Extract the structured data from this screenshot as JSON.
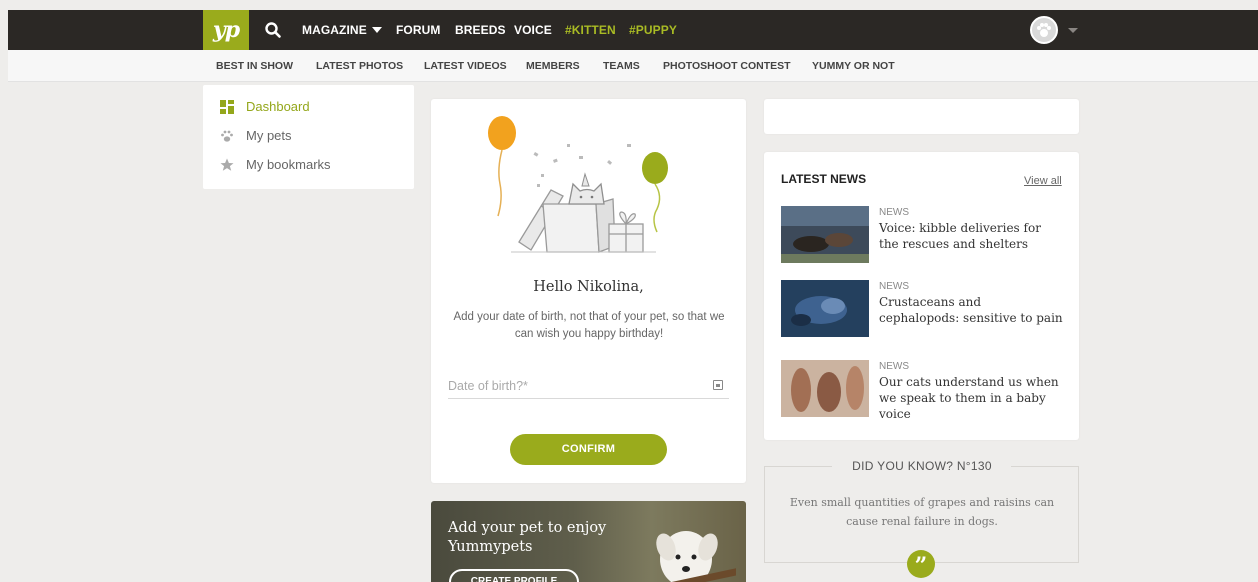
{
  "topbar": {
    "logo": "yp",
    "nav": [
      "MAGAZINE",
      "FORUM",
      "BREEDS",
      "VOICE",
      "#KITTEN",
      "#PUPPY"
    ]
  },
  "subnav": [
    "BEST IN SHOW",
    "LATEST PHOTOS",
    "LATEST VIDEOS",
    "MEMBERS",
    "TEAMS",
    "PHOTOSHOOT CONTEST",
    "YUMMY OR NOT"
  ],
  "sidebar": {
    "items": [
      {
        "label": "Dashboard",
        "icon": "dashboard-icon",
        "active": true
      },
      {
        "label": "My pets",
        "icon": "paw-icon"
      },
      {
        "label": "My bookmarks",
        "icon": "star-icon"
      }
    ]
  },
  "birthday": {
    "greeting": "Hello Nikolina,",
    "intro": "Add your date of birth, not that of your pet, so that we can wish you happy birthday!",
    "dob_placeholder": "Date of birth?*",
    "confirm_label": "CONFIRM"
  },
  "promo": {
    "text": "Add your pet to enjoy Yummypets",
    "button_label": "CREATE PROFILE"
  },
  "news": {
    "title": "LATEST NEWS",
    "view_all": "View all",
    "items": [
      {
        "category": "NEWS",
        "headline": "Voice: kibble deliveries for the rescues and shelters"
      },
      {
        "category": "NEWS",
        "headline": "Crustaceans and cephalopods: sensitive to pain"
      },
      {
        "category": "NEWS",
        "headline": "Our cats understand us when we speak to them in a baby voice"
      }
    ]
  },
  "did_you_know": {
    "title": "DID YOU KNOW? N°130",
    "text": "Even small quantities of grapes and raisins can cause renal failure in dogs."
  },
  "colors": {
    "brand_green": "#9aab1c",
    "topbar_bg": "#2b2825",
    "page_bg": "#eeedeb"
  }
}
